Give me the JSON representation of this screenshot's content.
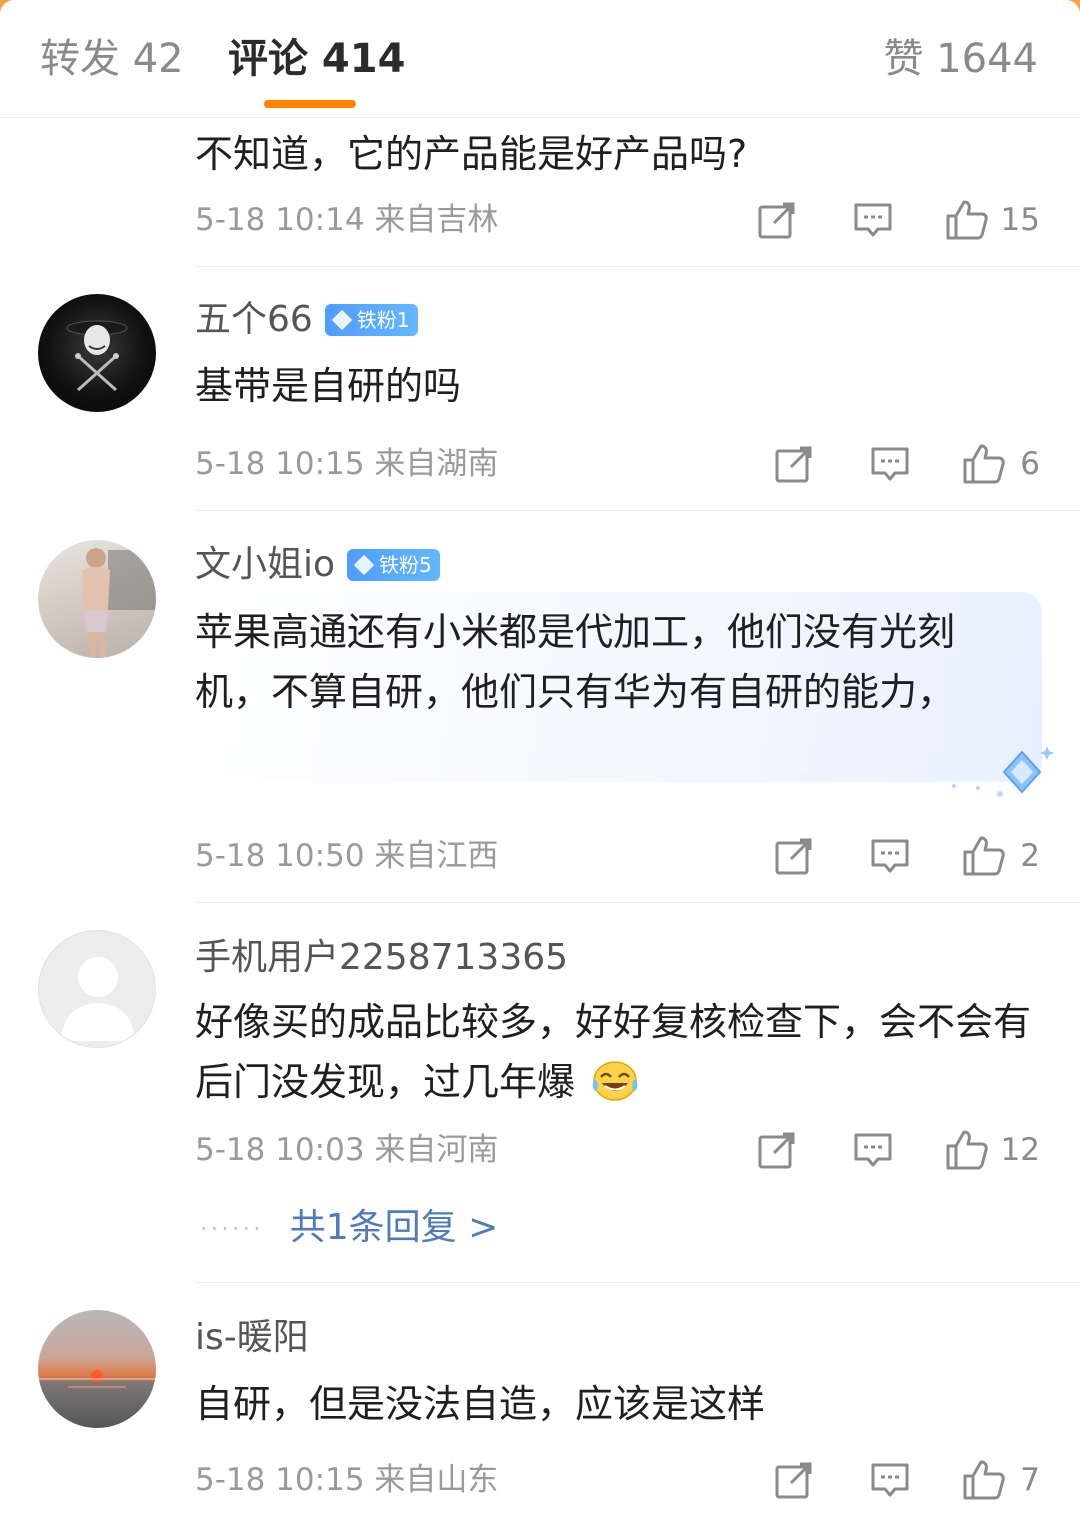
{
  "tabs": {
    "reposts": "转发 42",
    "comments": "评论 414",
    "likes": "赞 1644"
  },
  "colors": {
    "accent": "#ff8200",
    "link": "#4f7cb8",
    "badge": "#4f9dff"
  },
  "comments": [
    {
      "username": "",
      "text": "不知道，它的产品能是好产品吗?",
      "meta": "5-18 10:14 来自吉林",
      "likes": "15"
    },
    {
      "username": "五个66",
      "badge": "铁粉1",
      "text": "基带是自研的吗",
      "meta": "5-18 10:15 来自湖南",
      "likes": "6"
    },
    {
      "username": "文小姐io",
      "badge": "铁粉5",
      "text": "苹果高通还有小米都是代加工，他们没有光刻机，不算自研，他们只有华为有自研的能力，",
      "meta": "5-18 10:50 来自江西",
      "likes": "2"
    },
    {
      "username": "手机用户2258713365",
      "text": "好像买的成品比较多，好好复核检查下，会不会有后门没发现，过几年爆",
      "meta": "5-18 10:03 来自河南",
      "likes": "12",
      "replies": "共1条回复 >"
    },
    {
      "username": "is-暖阳",
      "text": "自研，但是没法自造，应该是这样",
      "meta": "5-18 10:15 来自山东",
      "likes": "7"
    }
  ],
  "icons": [
    "share-icon",
    "reply-icon",
    "like-icon",
    "laughing-emoji-icon",
    "diamond-badge-icon"
  ]
}
